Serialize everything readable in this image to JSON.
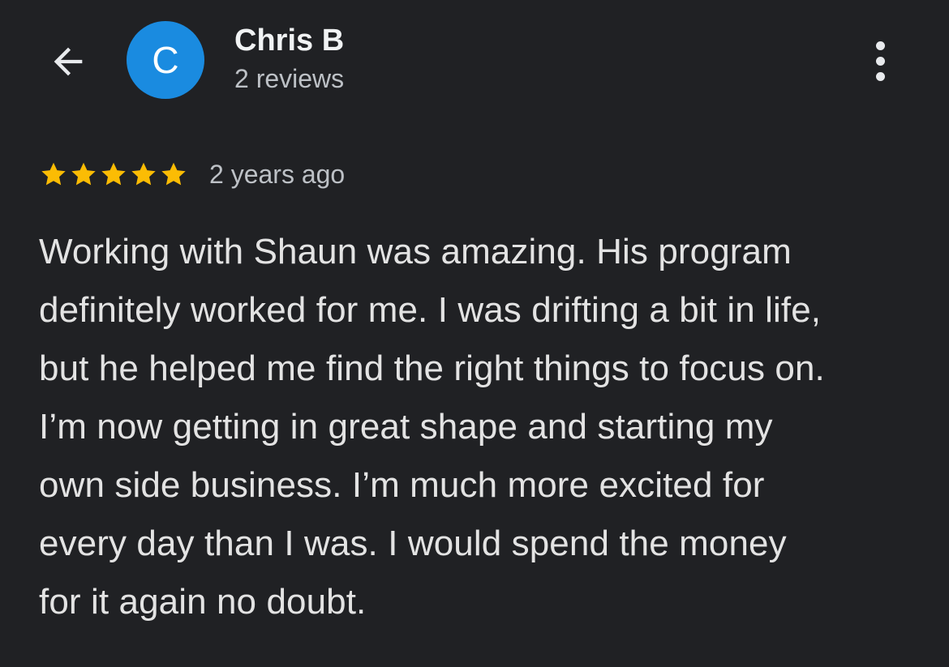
{
  "header": {
    "back_icon": "arrow-left-icon",
    "avatar_letter": "C",
    "avatar_color": "#1a8be0",
    "user_name": "Chris B",
    "review_count": "2 reviews",
    "more_icon": "more-vert-icon"
  },
  "review": {
    "rating": 5,
    "max_rating": 5,
    "star_color": "#fbbc04",
    "date": "2 years ago",
    "text_lines": [
      "Working with Shaun was amazing. His program",
      "definitely worked for me. I was drifting a bit in life,",
      "but he helped me find the right things to focus on.",
      "I’m now getting in great shape and starting my",
      "own side business. I’m much more excited for",
      "every day than I was. I would spend the money",
      "for it again no doubt."
    ]
  }
}
